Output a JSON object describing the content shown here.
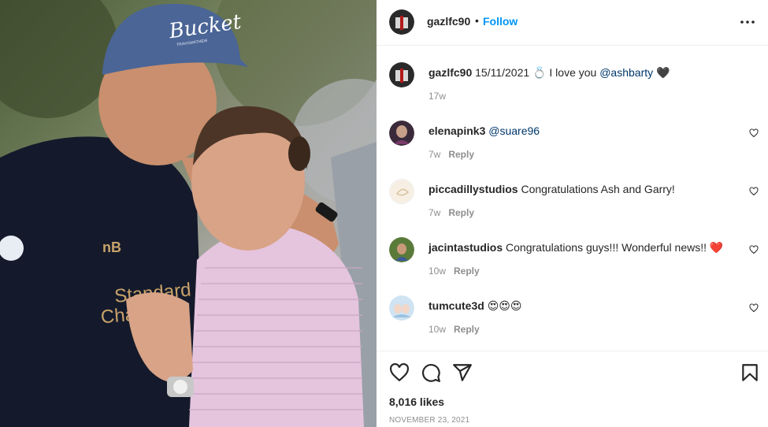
{
  "post": {
    "author": "gazlfc90",
    "follow_label": "Follow",
    "separator": "•",
    "photo_description_icon": "couple-photo",
    "cap_text": "Bucket",
    "cap_subtext": "TRAVISMATHEW",
    "shirt_text_1": "Standard",
    "shirt_text_2": "Chartered"
  },
  "caption": {
    "username": "gazlfc90",
    "date_text": "15/11/2021",
    "emoji_ring": "💍",
    "text": "I love you",
    "mention": "@ashbarty",
    "emoji_heart": "🖤",
    "age": "17w"
  },
  "comments": [
    {
      "username": "elenapink3",
      "text": "",
      "mention": "@suare96",
      "age": "7w",
      "reply": "Reply",
      "avatar_color": "#3a2a3a"
    },
    {
      "username": "piccadillystudios",
      "text": "Congratulations Ash and Garry!",
      "mention": "",
      "age": "7w",
      "reply": "Reply",
      "avatar_color": "#e9dcc8"
    },
    {
      "username": "jacintastudios",
      "text": "Congratulations guys!!! Wonderful news!!",
      "mention": "",
      "emoji": "❤️",
      "age": "10w",
      "reply": "Reply",
      "avatar_color": "#7a5030"
    },
    {
      "username": "tumcute3d",
      "text": "",
      "mention": "",
      "emoji": "😍😍😍",
      "age": "10w",
      "reply": "Reply",
      "avatar_color": "#9cc3e0"
    }
  ],
  "actions": {
    "like_icon": "heart-outline-icon",
    "comment_icon": "comment-icon",
    "share_icon": "paper-plane-icon",
    "save_icon": "bookmark-icon"
  },
  "likes_text": "8,016 likes",
  "post_date": "NOVEMBER 23, 2021",
  "colors": {
    "accent": "#0095f6",
    "mention": "#00376b",
    "muted": "#8e8e8e",
    "heart_red": "#e0245e"
  }
}
